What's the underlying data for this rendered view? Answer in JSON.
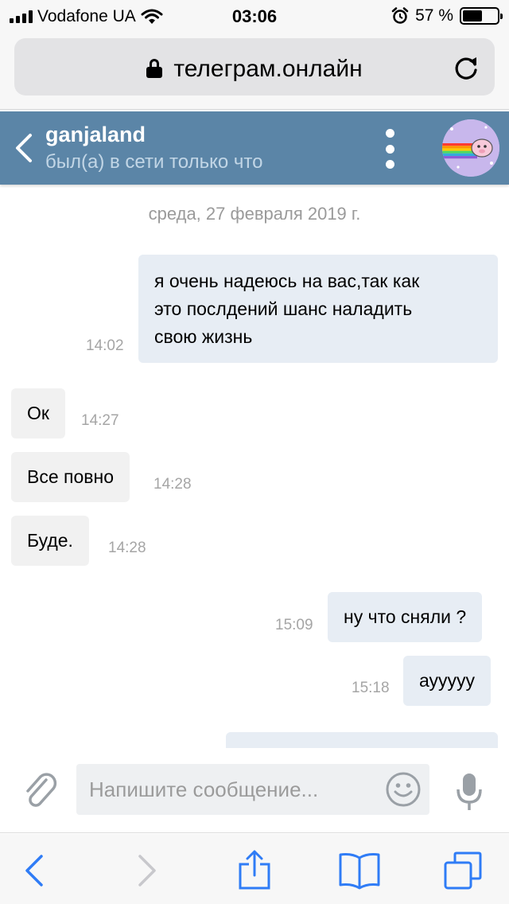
{
  "status_bar": {
    "carrier": "Vodafone UA",
    "time": "03:06",
    "battery_percent": "57 %",
    "battery_level": 0.57,
    "signal_bars": 4,
    "wifi_icon": "wifi-icon",
    "alarm_icon": "alarm-icon"
  },
  "browser": {
    "url": "телеграм.онлайн",
    "lock_icon": "lock-icon",
    "reload_icon": "reload-icon"
  },
  "chat_header": {
    "name": "ganjaland",
    "status": "был(а) в сети только что",
    "back_icon": "chevron-left-icon",
    "menu_icon": "more-vertical-icon",
    "avatar": "nyan-cat-avatar"
  },
  "messages": {
    "date_separator": "среда, 27 февраля 2019 г.",
    "items": [
      {
        "direction": "outgoing",
        "lines": [
          "я очень надеюсь на вас,так как",
          "это послдений шанс наладить",
          "свою жизнь"
        ],
        "time": "14:02"
      },
      {
        "direction": "incoming",
        "text": "Ок",
        "time": "14:27"
      },
      {
        "direction": "incoming",
        "text": "Все повно",
        "time": "14:28"
      },
      {
        "direction": "incoming",
        "text": "Буде.",
        "time": "14:28"
      },
      {
        "direction": "outgoing",
        "text": "ну что сняли ?",
        "time": "15:09"
      },
      {
        "direction": "outgoing",
        "text": "ауyyyy",
        "time": "15:18"
      }
    ]
  },
  "composer": {
    "placeholder": "Напишите сообщение...",
    "value": "",
    "attach_icon": "paperclip-icon",
    "emoji_icon": "smiley-icon",
    "mic_icon": "microphone-icon"
  },
  "toolbar": {
    "icons": [
      "back-arrow-icon",
      "forward-arrow-icon",
      "share-icon",
      "bookmarks-icon",
      "tabs-icon"
    ]
  },
  "colors": {
    "header_bg": "#5b85a7",
    "ios_blue": "#2f7cf6",
    "incoming_bubble": "#f1f1f1",
    "outgoing_bubble": "#e7edf4"
  }
}
